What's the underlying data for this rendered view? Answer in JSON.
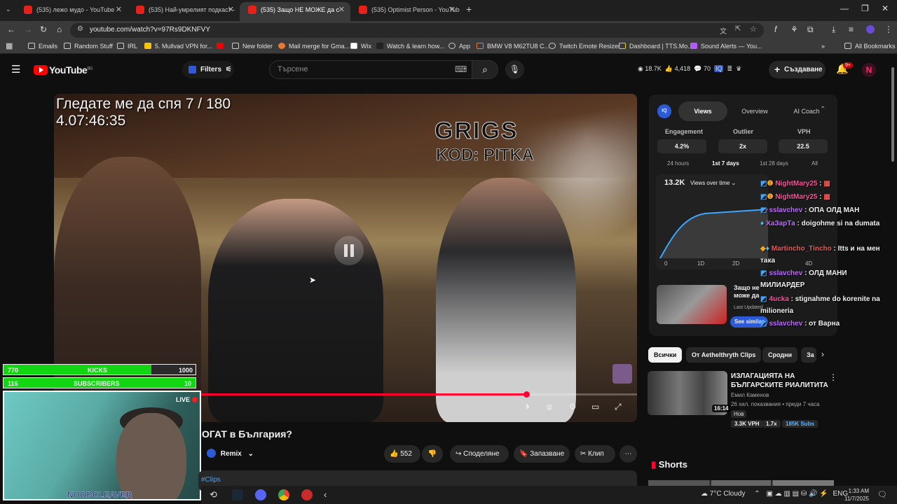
{
  "browser": {
    "tabs": [
      {
        "title": "(535) лежо мудо - YouTube",
        "active": false
      },
      {
        "title": "(535) Най-умрелият подкаст -",
        "active": false
      },
      {
        "title": "(535) Защо НЕ МОЖЕ да с",
        "active": true
      },
      {
        "title": "(535) Optimist Person - YouTub",
        "active": false
      }
    ],
    "url": "youtube.com/watch?v=97Rs9DKNFVY",
    "bookmarks": [
      "Emails",
      "Random Stuff",
      "IRL",
      "5. Mullvad VPN for...",
      "New folder",
      "Mail merge for Gma...",
      "Wix",
      "Watch & learn how...",
      "App",
      "BMW V8 M62TU8 C...",
      "Twitch Emote Resizer",
      "Dashboard | TTS.Mo...",
      "Sound Alerts — You..."
    ],
    "all_bookmarks": "All Bookmarks"
  },
  "yt_header": {
    "logo": "YouTube",
    "logo_country": "BG",
    "filters_label": "Filters",
    "search_placeholder": "Търсене",
    "stats": {
      "views": "18.7K",
      "likes": "4,418",
      "comments": "70"
    },
    "create_label": "Създаване",
    "notif_count": "9+",
    "avatar_letter": "N"
  },
  "video": {
    "overlay_line1": "Гледате ме да спя 7 / 180",
    "overlay_line2": "4.07:46:35",
    "overlay_logo": "GRIGS",
    "overlay_sub": "KOD: PITKA",
    "progress_fraction": 0.81,
    "title": "ОГАТ в България?"
  },
  "stream_overlay": {
    "kicks_current": "770",
    "kicks_label": "KICKS",
    "kicks_goal": "1000",
    "kicks_fraction": 0.77,
    "subs_current": "116",
    "subs_label": "SUBSCRIBERS",
    "subs_goal": "10",
    "subs_fraction": 1.0,
    "live_label": "LIVE",
    "streamer_name": "NOOBCLEAVER"
  },
  "actions": {
    "remix": "Remix",
    "likes": "552",
    "share": "Споделяне",
    "save": "Запазване",
    "clip": "Клип",
    "hashtag": "#Clips"
  },
  "stats_panel": {
    "tabs": [
      "Views",
      "Overview",
      "AI Coach"
    ],
    "metrics": [
      {
        "label": "Engagement",
        "value": "4.2%"
      },
      {
        "label": "Outlier",
        "value": "2x"
      },
      {
        "label": "VPH",
        "value": "22.5"
      }
    ],
    "ranges": [
      "24 hours",
      "1st 7 days",
      "1st 28 days",
      "All"
    ],
    "total": "13.2K",
    "dropdown": "Views over time",
    "x_ticks": [
      "0",
      "1D",
      "2D",
      "4D"
    ],
    "similar_title": "Защо не може да сте млад и БОГАТ в България?",
    "similar_sub": "Last Updated",
    "similar_btn": "See similar"
  },
  "chat": [
    {
      "name": "NightMary25",
      "text": ":",
      "color": "#ff4f9a"
    },
    {
      "name": "NightMary25",
      "text": ":",
      "color": "#ff4f9a"
    },
    {
      "name": "sslavchev",
      "text": ": ОПА ОЛД МАН",
      "color": "#c06bff"
    },
    {
      "name": "ХаЗарТа",
      "text": ": doigohme si na dumata",
      "color": "#c06bff"
    },
    {
      "name": "Martincho_Tincho",
      "text": ": Itts и на мен така",
      "color": "#ff4f4f"
    },
    {
      "name": "sslavchev",
      "text": ": ОЛД МАНИ МИЛИАРДЕР",
      "color": "#c06bff"
    },
    {
      "name": "4ucka",
      "text": ": stignahme do korenite na milioneria",
      "color": "#ff4f9a"
    },
    {
      "name": "sslavchev",
      "text": ": от Варна",
      "color": "#c06bff"
    }
  ],
  "chips": [
    "Всички",
    "От Aethelthryth Clips",
    "Сродни",
    "За"
  ],
  "recommendation": {
    "title": "ИЗЛАГАЦИЯТА НА БЪЛГАРСКИТЕ РИАЛИТИТА",
    "channel": "Емил Каменов",
    "meta": "26 хил. показвания • преди 7 часа",
    "badge": "Нов",
    "duration": "16:14",
    "vph": "3.3K VPH",
    "outlier": "1.7x",
    "subs": "185K Subs"
  },
  "shorts_label": "Shorts",
  "system": {
    "weather": "7°C  Cloudy",
    "lang": "ENG",
    "time": "1:33 AM",
    "date": "11/7/2025"
  }
}
